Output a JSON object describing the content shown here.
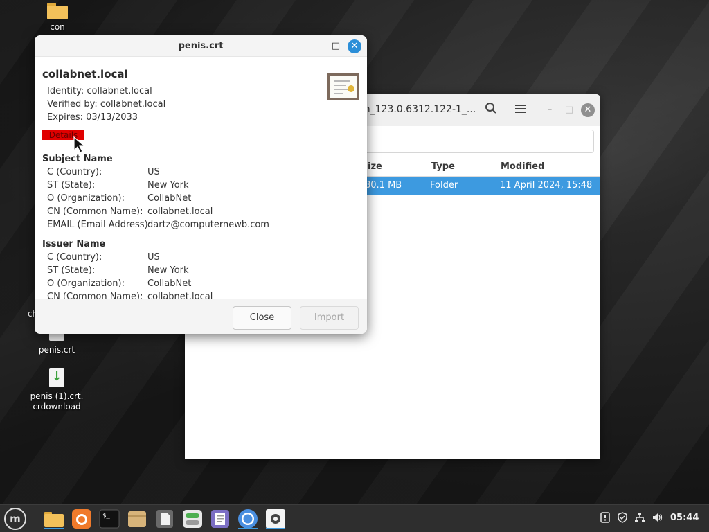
{
  "desktop": {
    "icons": [
      {
        "label": "con"
      },
      {
        "label": "ch"
      },
      {
        "label": "penis.crt"
      },
      {
        "label": "penis (1).crt.\ncrdownload"
      }
    ]
  },
  "file_manager": {
    "title": "m_123.0.6312.122-1_...",
    "columns": [
      "ize",
      "Type",
      "Modified"
    ],
    "rows": [
      {
        "size": "80.1 MB",
        "type": "Folder",
        "modified": "11 April 2024, 15:48"
      }
    ]
  },
  "dialog": {
    "title": "penis.crt",
    "cert_name": "collabnet.local",
    "identity": "Identity: collabnet.local",
    "verified_by": "Verified by: collabnet.local",
    "expires": "Expires: 03/13/2033",
    "details_label": "Details",
    "subject": {
      "heading": "Subject Name",
      "fields": [
        {
          "key": "C (Country):",
          "value": "US"
        },
        {
          "key": "ST (State):",
          "value": "New York"
        },
        {
          "key": "O (Organization):",
          "value": "CollabNet"
        },
        {
          "key": "CN (Common Name):",
          "value": "collabnet.local"
        },
        {
          "key": "EMAIL (Email Address):",
          "value": "dartz@computernewb.com"
        }
      ]
    },
    "issuer": {
      "heading": "Issuer Name",
      "fields": [
        {
          "key": "C (Country):",
          "value": "US"
        },
        {
          "key": "ST (State):",
          "value": "New York"
        },
        {
          "key": "O (Organization):",
          "value": "CollabNet"
        },
        {
          "key": "CN (Common Name):",
          "value": "collabnet.local"
        }
      ]
    },
    "close_label": "Close",
    "import_label": "Import"
  },
  "taskbar": {
    "menu_icon": "linux-mint-menu-icon",
    "apps": [
      "files-icon",
      "firefox-icon",
      "terminal-icon",
      "archive-icon",
      "text-file-icon",
      "settings-toggle-icon",
      "document-viewer-icon",
      "chromium-icon",
      "system-settings-icon"
    ],
    "tray": [
      "update-icon",
      "shield-icon",
      "network-icon",
      "volume-icon"
    ],
    "clock": "05:44"
  },
  "colors": {
    "accent": "#3d9ae0",
    "details_highlight": "#e00000",
    "dialog_close": "#2c8fd8"
  }
}
